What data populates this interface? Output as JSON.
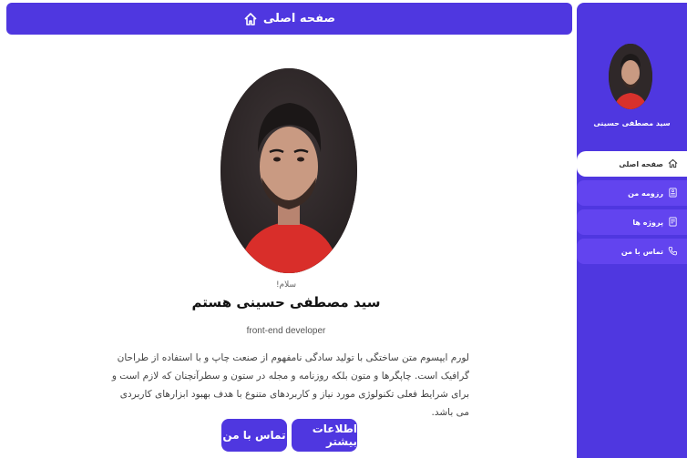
{
  "header": {
    "title": "صفحه اصلی"
  },
  "sidebar": {
    "name": "سید مصطفی حسینی",
    "items": [
      {
        "label": "صفحه اصلی",
        "icon": "home-icon",
        "active": true
      },
      {
        "label": "رزومه من",
        "icon": "resume-icon",
        "active": false
      },
      {
        "label": "پروژه ها",
        "icon": "projects-icon",
        "active": false
      },
      {
        "label": "تماس با من",
        "icon": "phone-icon",
        "active": false
      }
    ]
  },
  "main": {
    "greeting": "سلام!",
    "title": "سید مصطفی حسینی هستم",
    "role": "front-end developer",
    "description": "لورم ایپسوم متن ساختگی با تولید سادگی نامفهوم از صنعت چاپ و با استفاده از طراحان گرافیک است. چاپگرها و متون بلکه روزنامه و مجله در ستون و سطرآنچنان که لازم است و برای شرایط فعلی تکنولوژی مورد نیاز و کاربردهای متنوع با هدف بهبود ابزارهای کاربردی می باشد.",
    "buttons": {
      "more": "اطلاعات بیشتر",
      "contact": "تماس با من"
    }
  },
  "colors": {
    "accent": "#4f37e0",
    "accent_light": "#6244ef",
    "background": "#ffffff"
  }
}
